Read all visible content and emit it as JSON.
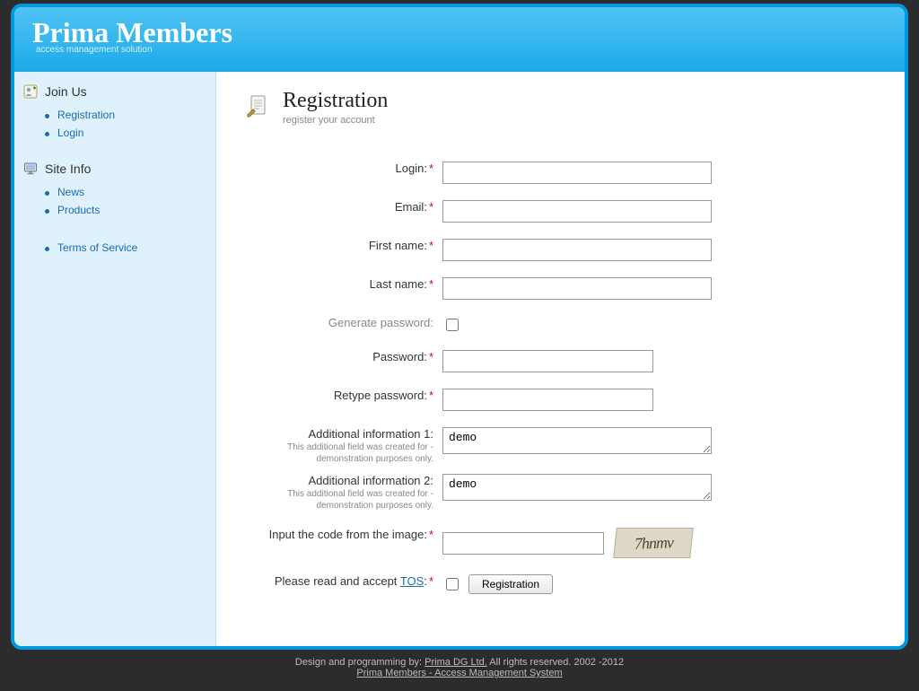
{
  "brand": {
    "title": "Prima Members",
    "subtitle": "access management solution"
  },
  "sidebar": {
    "sections": [
      {
        "label": "Join Us",
        "icon": "user-plus-icon",
        "items": [
          "Registration",
          "Login"
        ]
      },
      {
        "label": "Site Info",
        "icon": "monitor-icon",
        "items": [
          "News",
          "Products"
        ]
      }
    ],
    "extra": [
      "Terms of Service"
    ]
  },
  "page": {
    "title": "Registration",
    "subtitle": "register your account"
  },
  "form": {
    "login_label": "Login:",
    "email_label": "Email:",
    "first_name_label": "First name:",
    "last_name_label": "Last name:",
    "generate_password_label": "Generate password:",
    "password_label": "Password:",
    "retype_password_label": "Retype password:",
    "addl1_label": "Additional information 1:",
    "addl1_hint": "This additional field was created for - demonstration purposes only.",
    "addl1_value": "demo",
    "addl2_label": "Additional information 2:",
    "addl2_hint": "This additional field was created for - demonstration purposes only.",
    "addl2_value": "demo",
    "captcha_label": "Input the code from the image:",
    "captcha_text": "7hnmv",
    "tos_prefix": "Please read and accept ",
    "tos_link": "TOS",
    "tos_suffix": ":",
    "submit_label": "Registration"
  },
  "footer": {
    "design_prefix": "Design and programming by: ",
    "design_link": "Prima DG Ltd.",
    "design_rest": " All rights reserved. 2002 -2012",
    "product_link": "Prima Members - Access Management System"
  }
}
